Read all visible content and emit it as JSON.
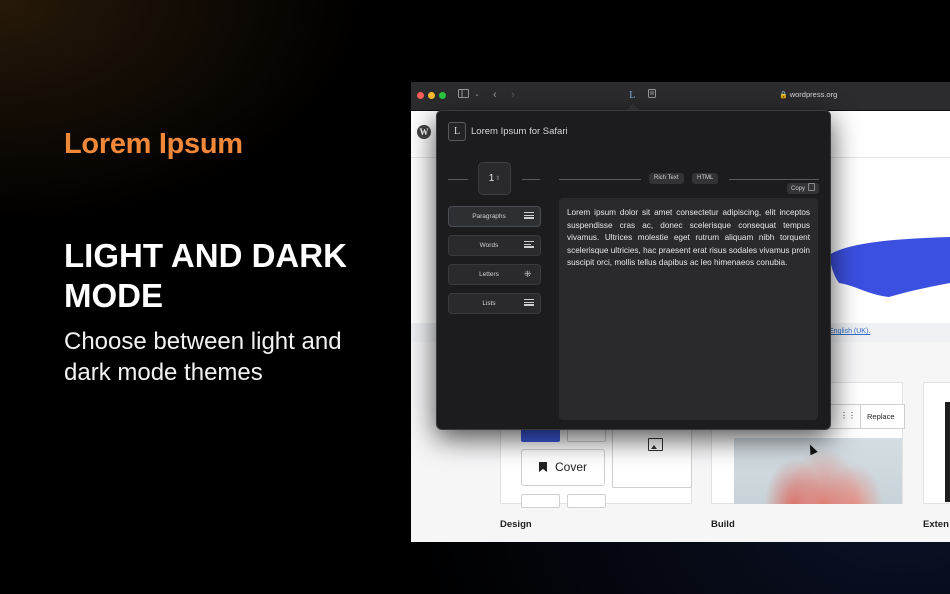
{
  "promo": {
    "brand": "Lorem Ipsum",
    "headline": "LIGHT AND DARK MODE",
    "subheadline": "Choose between light and dark mode themes",
    "brand_color": "#f0883a"
  },
  "browser": {
    "url": "wordpress.org",
    "page": {
      "notice_link": "English (UK).",
      "cover_label": "Cover",
      "replace_label": "Replace",
      "gallery_labels": [
        "Design",
        "Build",
        "Exten"
      ]
    }
  },
  "extension": {
    "title": "Lorem Ipsum for Safari",
    "count": "1",
    "modes": [
      "Rich Text",
      "HTML"
    ],
    "copy_label": "Copy",
    "types": [
      {
        "label": "Paragraphs",
        "icon": "paragraphs-icon",
        "active": true
      },
      {
        "label": "Words",
        "icon": "words-icon",
        "active": false
      },
      {
        "label": "Letters",
        "icon": "letters-icon",
        "active": false
      },
      {
        "label": "Lists",
        "icon": "lists-icon",
        "active": false
      }
    ],
    "output_text": "Lorem ipsum dolor sit amet consectetur adipiscing, elit inceptos suspendisse cras ac, donec scelerisque consequat tempus vivamus. Ultrices molestie eget rutrum aliquam nibh torquent scelerisque ultricies, hac praesent erat risus sodales vivamus proin suscipit orci, mollis tellus dapibus ac leo himenaeos conubia."
  }
}
